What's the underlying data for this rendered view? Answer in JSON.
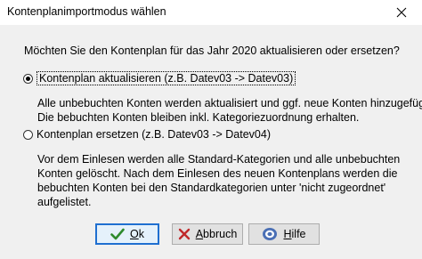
{
  "window": {
    "title": "Kontenplanimportmodus wählen"
  },
  "dialog": {
    "prompt": "Möchten Sie den Kontenplan für das Jahr 2020 aktualisieren oder ersetzen?",
    "options": [
      {
        "label": "Kontenplan aktualisieren (z.B. Datev03 -> Datev03)",
        "selected": true,
        "description": [
          "Alle unbebuchten Konten werden aktualisiert und ggf. neue Konten hinzugefügt.",
          "Die bebuchten Konten bleiben inkl. Kategoriezuordnung erhalten."
        ]
      },
      {
        "label": "Kontenplan ersetzen (z.B. Datev03 -> Datev04)",
        "selected": false,
        "description": [
          "Vor dem Einlesen werden alle Standard-Kategorien und alle unbebuchten",
          "Konten gelöscht. Nach dem Einlesen des neuen Kontenplans werden die",
          "bebuchten Konten bei den Standardkategorien unter 'nicht zugeordnet'",
          "aufgelistet."
        ]
      }
    ]
  },
  "buttons": {
    "ok": {
      "label_mnemonic": "O",
      "label_rest": "k",
      "icon": "checkmark-icon",
      "color": "#2e8b2e"
    },
    "abbruch": {
      "label_mnemonic": "A",
      "label_rest": "bbruch",
      "icon": "x-icon",
      "color": "#c0282a"
    },
    "hilfe": {
      "label_mnemonic": "H",
      "label_rest": "ilfe",
      "icon": "help-icon",
      "color": "#4a6fb5"
    }
  },
  "colors": {
    "default_button_border": "#1f6fd0",
    "dialog_background": "#f0f0f0"
  }
}
